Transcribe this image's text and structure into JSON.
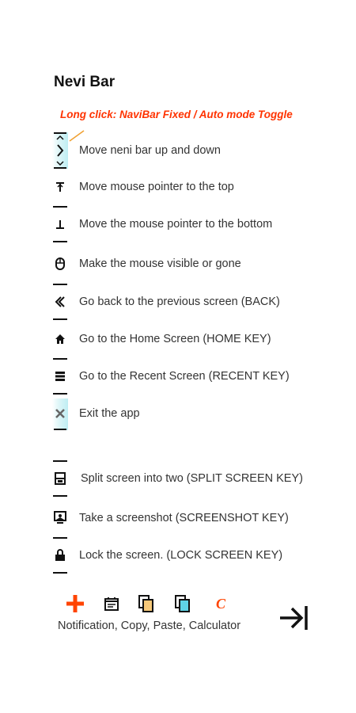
{
  "title": "Nevi Bar",
  "hint": "Long click: NaviBar Fixed / Auto mode Toggle",
  "rows": [
    {
      "icon": "move-up-down-icon",
      "label": "Move neni bar up and down"
    },
    {
      "icon": "pointer-top-icon",
      "label": "Move mouse pointer to the top"
    },
    {
      "icon": "pointer-bottom-icon",
      "label": "Move the mouse pointer to the bottom"
    },
    {
      "icon": "mouse-icon",
      "label": "Make the mouse visible or gone"
    },
    {
      "icon": "back-icon",
      "label": "Go back to the previous screen (BACK)"
    },
    {
      "icon": "home-icon",
      "label": "Go to the Home Screen (HOME KEY)"
    },
    {
      "icon": "recent-icon",
      "label": "Go to the Recent Screen (RECENT KEY)"
    },
    {
      "icon": "close-icon",
      "label": "Exit the app"
    },
    {
      "icon": "split-screen-icon",
      "label": "Split screen into two (SPLIT SCREEN KEY)"
    },
    {
      "icon": "screenshot-icon",
      "label": "Take a screenshot (SCREENSHOT KEY)"
    },
    {
      "icon": "lock-icon",
      "label": "Lock the screen. (LOCK SCREEN KEY)"
    }
  ],
  "toolbar": {
    "icons": [
      "plus-icon",
      "notification-icon",
      "copy-icon",
      "paste-icon",
      "calculator-icon"
    ],
    "calculator_glyph": "C",
    "caption": "Notification, Copy, Paste, Calculator"
  },
  "colors": {
    "accent": "#ff3300",
    "plus": "#ff4400",
    "teal": "#bfeef3",
    "text": "#333333"
  }
}
